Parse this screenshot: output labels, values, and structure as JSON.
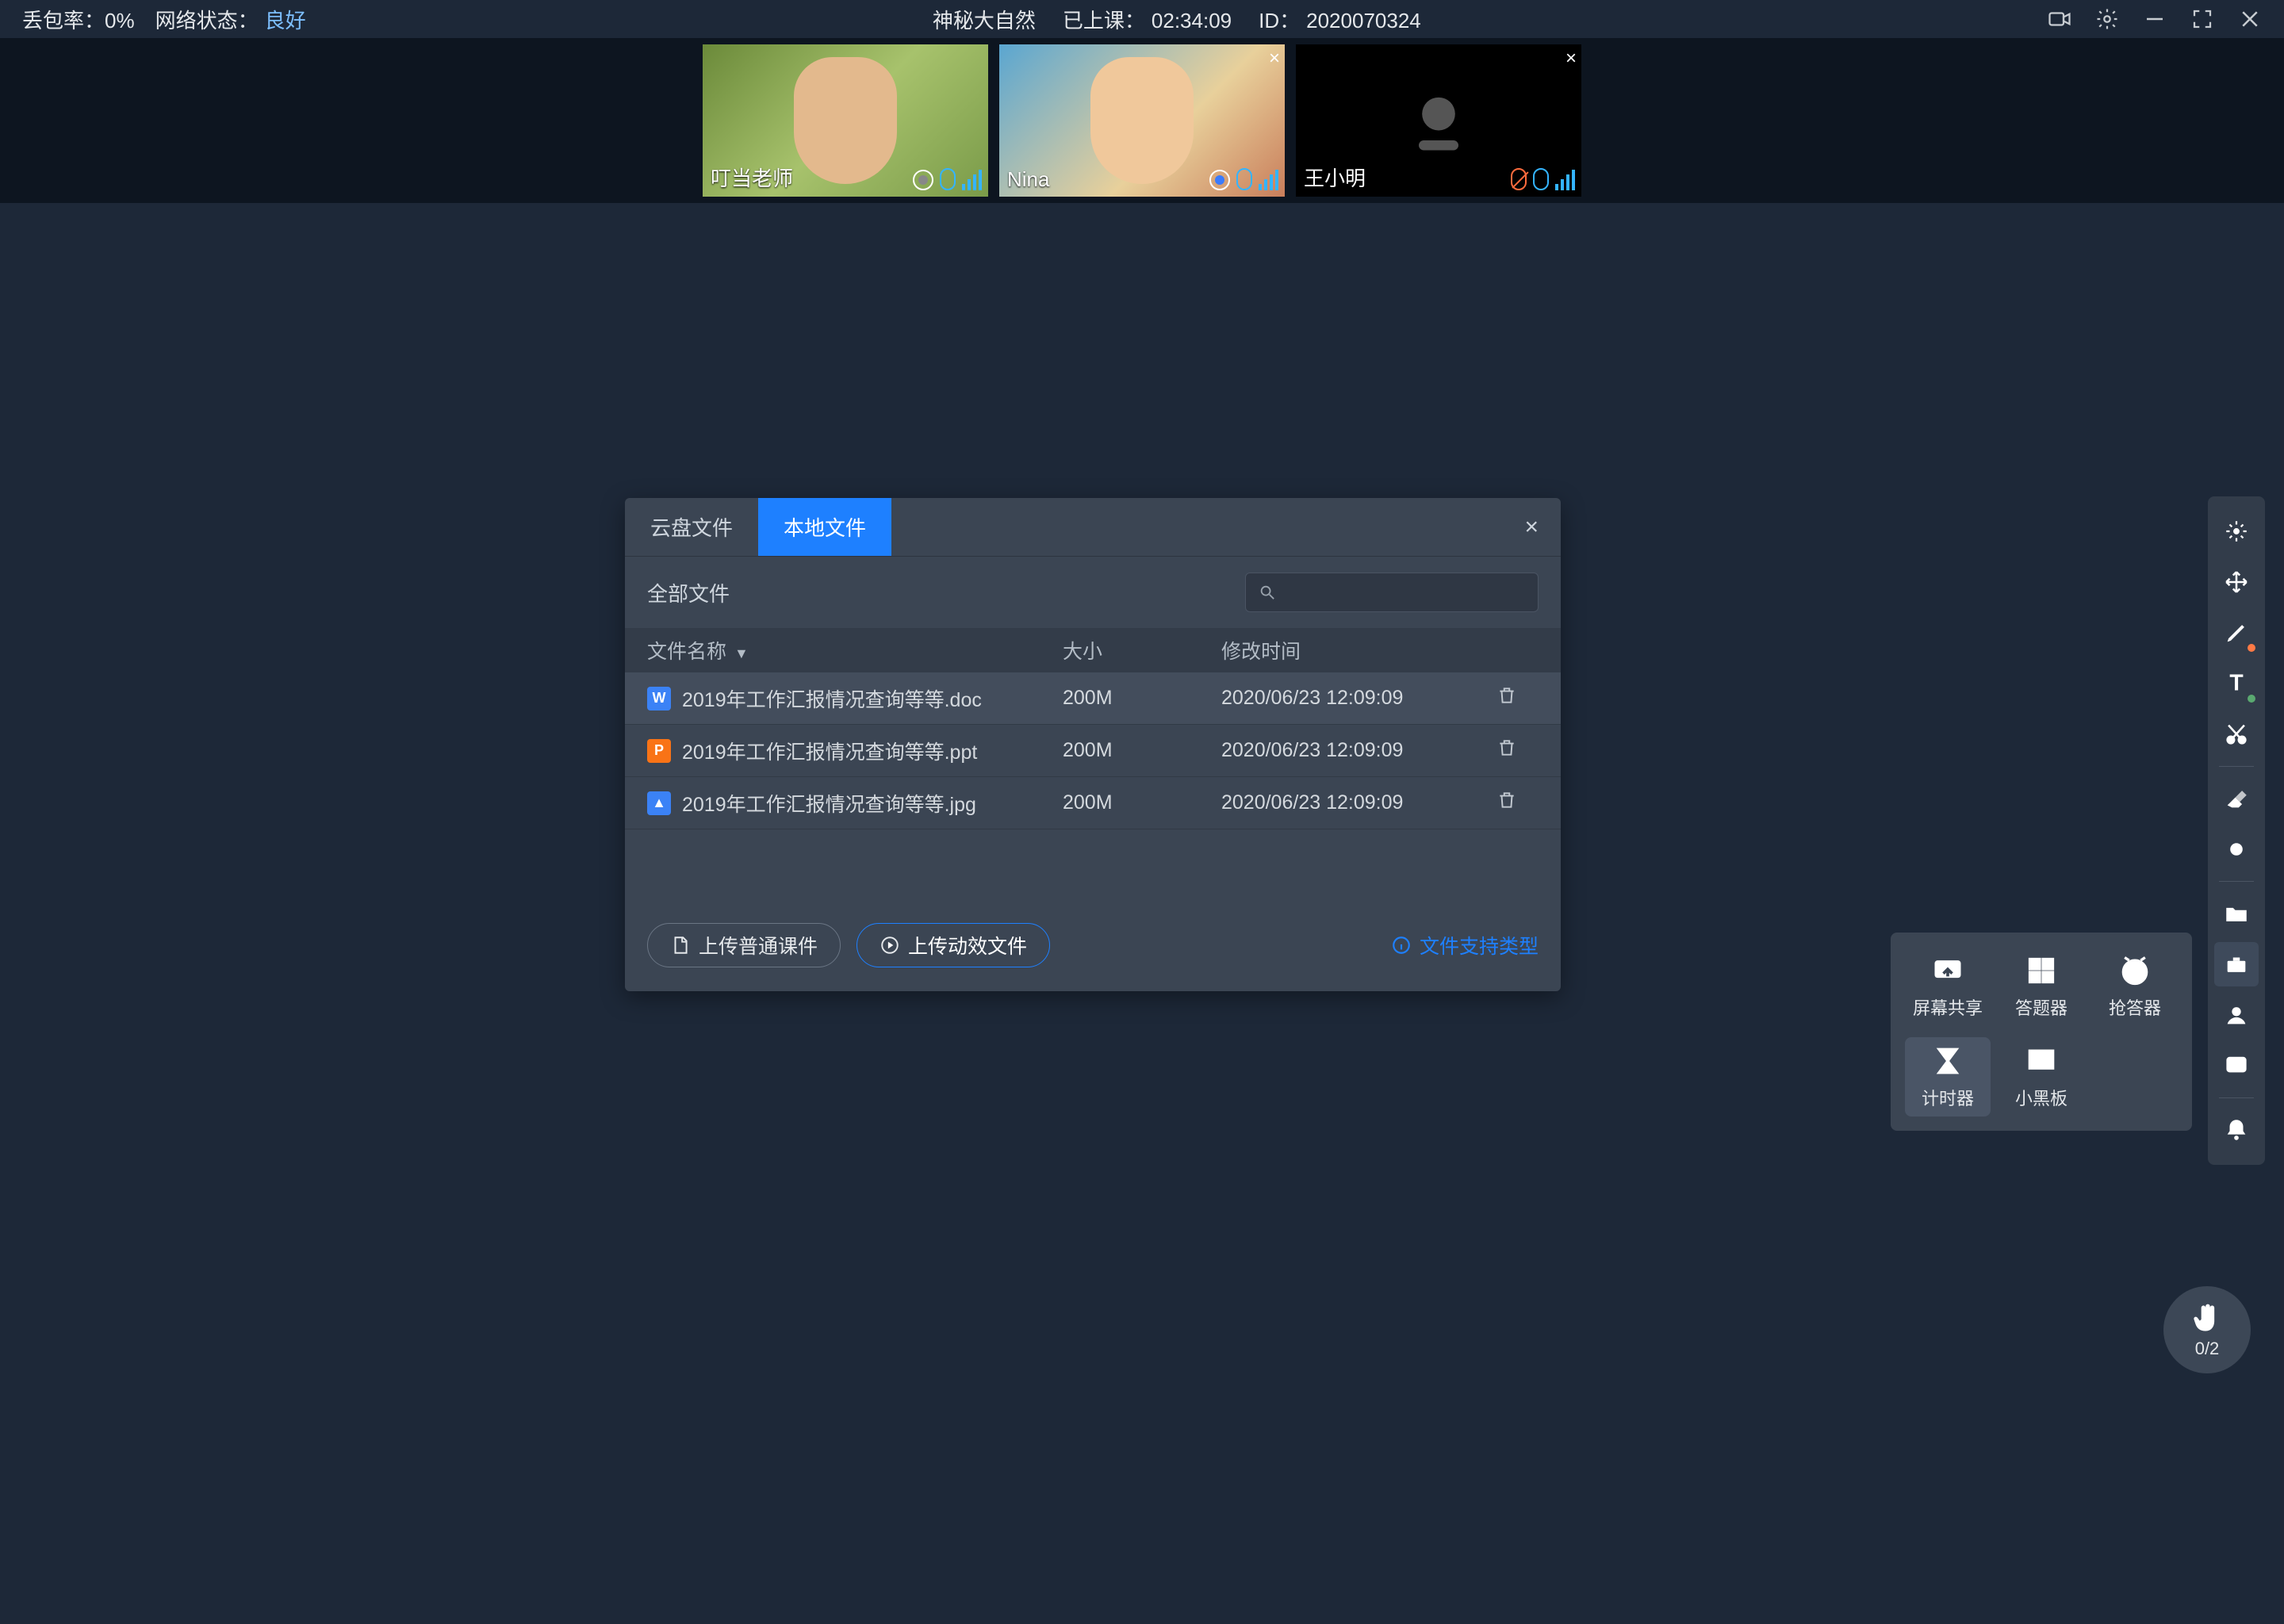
{
  "topbar": {
    "packet_label": "丢包率：",
    "packet_value": "0%",
    "net_label": "网络状态：",
    "net_value": "良好",
    "title": "神秘大自然",
    "elapsed_label": "已上课：",
    "elapsed_value": "02:34:09",
    "id_label": "ID：",
    "id_value": "2020070324"
  },
  "videos": [
    {
      "name": "叮当老师",
      "camera_off": false,
      "mic_muted": false,
      "closable": false,
      "recording": true
    },
    {
      "name": "Nina",
      "camera_off": false,
      "mic_muted": false,
      "closable": true,
      "recording": true
    },
    {
      "name": "王小明",
      "camera_off": true,
      "mic_muted": true,
      "closable": true,
      "recording": false
    }
  ],
  "dialog": {
    "tabs": {
      "cloud": "云盘文件",
      "local": "本地文件"
    },
    "active_tab": "local",
    "title": "全部文件",
    "search_placeholder": "",
    "columns": {
      "name": "文件名称",
      "size": "大小",
      "mtime": "修改时间"
    },
    "files": [
      {
        "icon": "W",
        "kind": "doc",
        "name": "2019年工作汇报情况查询等等.doc",
        "size": "200M",
        "mtime": "2020/06/23 12:09:09"
      },
      {
        "icon": "P",
        "kind": "ppt",
        "name": "2019年工作汇报情况查询等等.ppt",
        "size": "200M",
        "mtime": "2020/06/23 12:09:09"
      },
      {
        "icon": "▲",
        "kind": "jpg",
        "name": "2019年工作汇报情况查询等等.jpg",
        "size": "200M",
        "mtime": "2020/06/23 12:09:09"
      }
    ],
    "upload_normal": "上传普通课件",
    "upload_dynamic": "上传动效文件",
    "support_link": "文件支持类型"
  },
  "sidebar": {
    "items": [
      "laser-pointer",
      "move",
      "pen",
      "text",
      "scissors",
      "eraser",
      "record-dot",
      "folder",
      "toolbox",
      "user",
      "chat",
      "bell"
    ],
    "pen_badge": true,
    "text_badge": true
  },
  "popover": {
    "items": [
      {
        "id": "screen-share",
        "label": "屏幕共享"
      },
      {
        "id": "answer-tool",
        "label": "答题器"
      },
      {
        "id": "buzz-in",
        "label": "抢答器"
      },
      {
        "id": "timer",
        "label": "计时器"
      },
      {
        "id": "blackboard",
        "label": "小黑板"
      }
    ],
    "selected": "timer"
  },
  "fab": {
    "count": "0/2"
  }
}
